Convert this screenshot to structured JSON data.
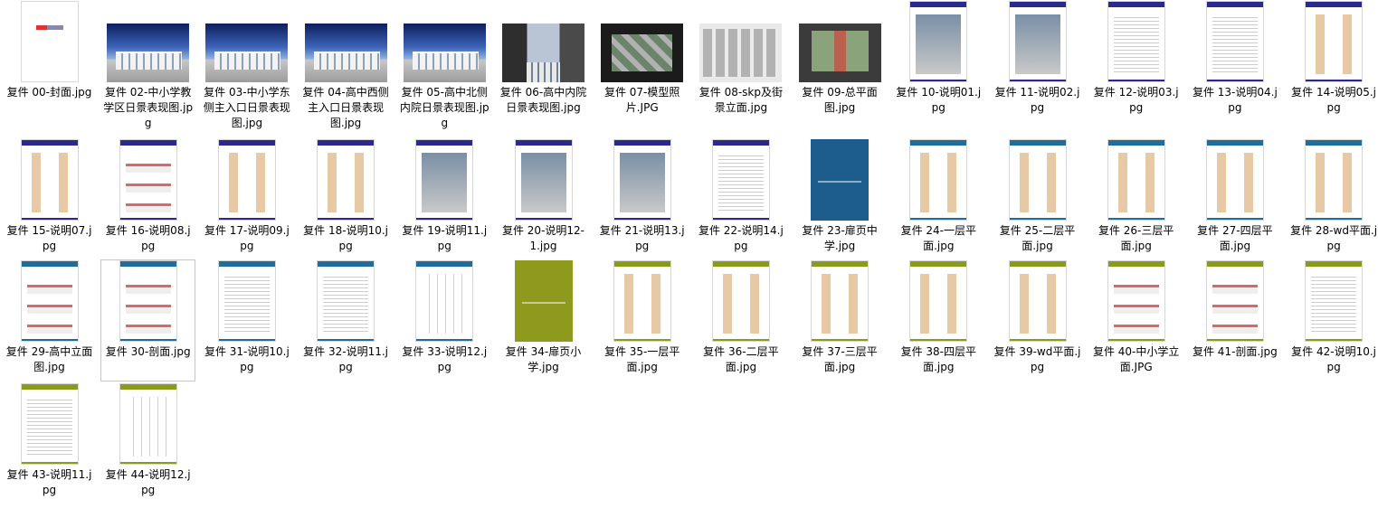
{
  "files": [
    {
      "name": "复件 00-封面.jpg",
      "thumb": "cover0"
    },
    {
      "name": "复件 02-中小学教学区日景表现图.jpg",
      "thumb": "sky"
    },
    {
      "name": "复件 03-中小学东侧主入口日景表现图.jpg",
      "thumb": "sky"
    },
    {
      "name": "复件 04-高中西侧主入口日景表现图.jpg",
      "thumb": "sky"
    },
    {
      "name": "复件 05-高中北侧内院日景表现图.jpg",
      "thumb": "sky"
    },
    {
      "name": "复件 06-高中内院日景表现图.jpg",
      "thumb": "court"
    },
    {
      "name": "复件 07-模型照片.JPG",
      "thumb": "model"
    },
    {
      "name": "复件 08-skp及街景立面.jpg",
      "thumb": "skp"
    },
    {
      "name": "复件 09-总平面图.jpg",
      "thumb": "site"
    },
    {
      "name": "复件 10-说明01.jpg",
      "thumb": "doc-blue-img"
    },
    {
      "name": "复件 11-说明02.jpg",
      "thumb": "doc-blue-img"
    },
    {
      "name": "复件 12-说明03.jpg",
      "thumb": "doc-blue-text"
    },
    {
      "name": "复件 13-说明04.jpg",
      "thumb": "doc-blue-text"
    },
    {
      "name": "复件 14-说明05.jpg",
      "thumb": "doc-blue-plan"
    },
    {
      "name": "复件 15-说明07.jpg",
      "thumb": "doc-blue-plan"
    },
    {
      "name": "复件 16-说明08.jpg",
      "thumb": "doc-blue-elev"
    },
    {
      "name": "复件 17-说明09.jpg",
      "thumb": "doc-blue-plan"
    },
    {
      "name": "复件 18-说明10.jpg",
      "thumb": "doc-blue-plan"
    },
    {
      "name": "复件 19-说明11.jpg",
      "thumb": "doc-blue-img"
    },
    {
      "name": "复件 20-说明12-1.jpg",
      "thumb": "doc-blue-img"
    },
    {
      "name": "复件 21-说明13.jpg",
      "thumb": "doc-blue-img"
    },
    {
      "name": "复件 22-说明14.jpg",
      "thumb": "doc-blue-text"
    },
    {
      "name": "复件 23-扉页中学.jpg",
      "thumb": "solid-blue"
    },
    {
      "name": "复件 24-一层平面.jpg",
      "thumb": "doc-teal-plan"
    },
    {
      "name": "复件 25-二层平面.jpg",
      "thumb": "doc-teal-plan"
    },
    {
      "name": "复件 26-三层平面.jpg",
      "thumb": "doc-teal-plan"
    },
    {
      "name": "复件 27-四层平面.jpg",
      "thumb": "doc-teal-plan"
    },
    {
      "name": "复件 28-wd平面.jpg",
      "thumb": "doc-teal-plan"
    },
    {
      "name": "复件 29-高中立面图.jpg",
      "thumb": "doc-teal-elev"
    },
    {
      "name": "复件 30-剖面.jpg",
      "thumb": "doc-teal-elev",
      "selected": true
    },
    {
      "name": "复件 31-说明10.jpg",
      "thumb": "doc-teal-text"
    },
    {
      "name": "复件 32-说明11.jpg",
      "thumb": "doc-teal-text"
    },
    {
      "name": "复件 33-说明12.jpg",
      "thumb": "doc-teal-table"
    },
    {
      "name": "复件 34-扉页小学.jpg",
      "thumb": "solid-olive"
    },
    {
      "name": "复件 35-一层平面.jpg",
      "thumb": "doc-olive-plan"
    },
    {
      "name": "复件 36-二层平面.jpg",
      "thumb": "doc-olive-plan"
    },
    {
      "name": "复件 37-三层平面.jpg",
      "thumb": "doc-olive-plan"
    },
    {
      "name": "复件 38-四层平面.jpg",
      "thumb": "doc-olive-plan"
    },
    {
      "name": "复件 39-wd平面.jpg",
      "thumb": "doc-olive-plan"
    },
    {
      "name": "复件 40-中小学立面.JPG",
      "thumb": "doc-olive-elev"
    },
    {
      "name": "复件 41-剖面.jpg",
      "thumb": "doc-olive-elev"
    },
    {
      "name": "复件 42-说明10.jpg",
      "thumb": "doc-olive-text"
    },
    {
      "name": "复件 43-说明11.jpg",
      "thumb": "doc-olive-text"
    },
    {
      "name": "复件 44-说明12.jpg",
      "thumb": "doc-olive-table"
    }
  ],
  "colors": {
    "blue_bar": "#2b2a8c",
    "teal_bar": "#1f6d9a",
    "olive_bar": "#8a9a1c",
    "blue_cover": "#1c5d8e",
    "olive_cover": "#8e9a1e",
    "selection_border": "#99d1ff"
  }
}
